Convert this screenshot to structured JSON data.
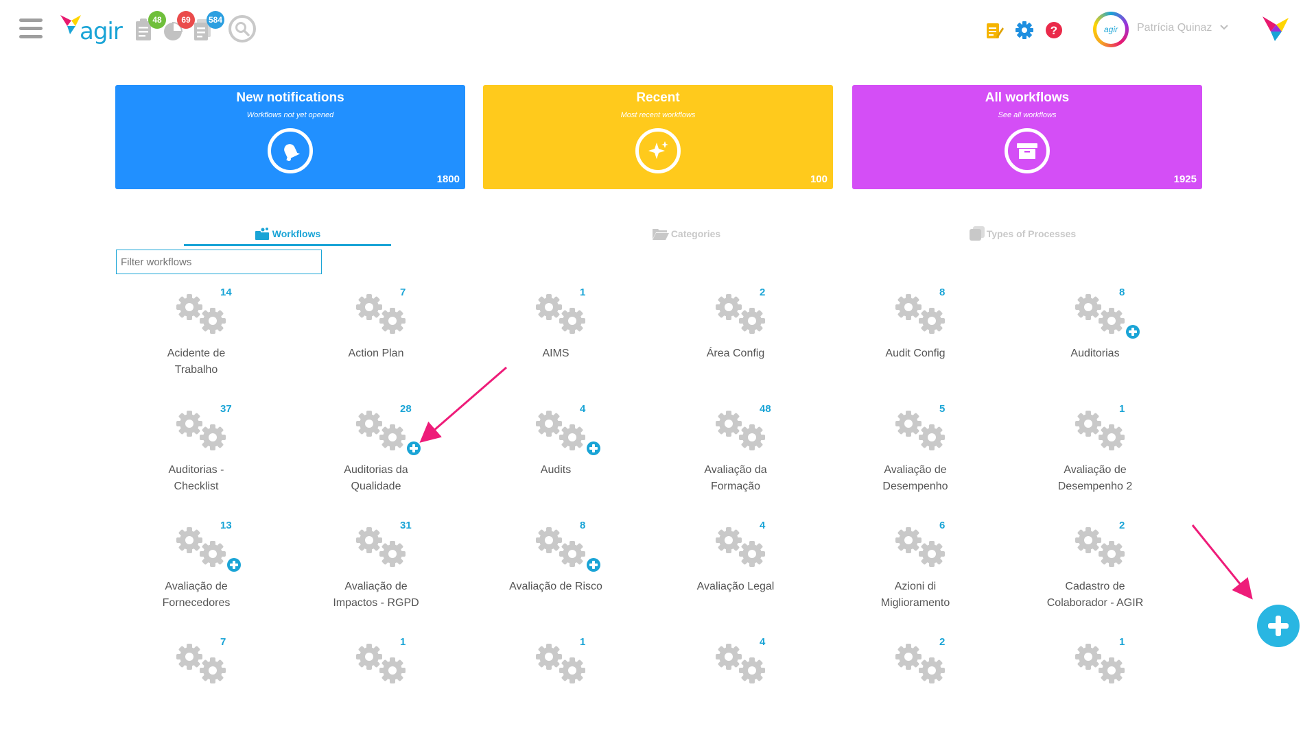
{
  "header": {
    "logo_text": "agir",
    "badges": {
      "tasks": "48",
      "charts": "69",
      "documents": "584"
    },
    "avatar_text": "agir",
    "user_name": "Patrícia Quinaz"
  },
  "cards": [
    {
      "title": "New notifications",
      "subtitle": "Workflows not yet opened",
      "count": "1800",
      "color": "#2190ff"
    },
    {
      "title": "Recent",
      "subtitle": "Most recent workflows",
      "count": "100",
      "color": "#ffca1c"
    },
    {
      "title": "All workflows",
      "subtitle": "See all workflows",
      "count": "1925",
      "color": "#d44ef6"
    }
  ],
  "tabs": {
    "workflows": "Workflows",
    "categories": "Categories",
    "types": "Types of Processes"
  },
  "filter": {
    "placeholder": "Filter workflows"
  },
  "workflows": [
    {
      "line1": "Acidente de",
      "line2": "Trabalho",
      "count": "14",
      "plus": false
    },
    {
      "line1": "Action Plan",
      "line2": "",
      "count": "7",
      "plus": false
    },
    {
      "line1": "AIMS",
      "line2": "",
      "count": "1",
      "plus": false
    },
    {
      "line1": "Área Config",
      "line2": "",
      "count": "2",
      "plus": false
    },
    {
      "line1": "Audit Config",
      "line2": "",
      "count": "8",
      "plus": false
    },
    {
      "line1": "Auditorias",
      "line2": "",
      "count": "8",
      "plus": true
    },
    {
      "line1": "Auditorias -",
      "line2": "Checklist",
      "count": "37",
      "plus": false
    },
    {
      "line1": "Auditorias da",
      "line2": "Qualidade",
      "count": "28",
      "plus": true
    },
    {
      "line1": "Audits",
      "line2": "",
      "count": "4",
      "plus": true
    },
    {
      "line1": "Avaliação da",
      "line2": "Formação",
      "count": "48",
      "plus": false
    },
    {
      "line1": "Avaliação de",
      "line2": "Desempenho",
      "count": "5",
      "plus": false
    },
    {
      "line1": "Avaliação de",
      "line2": "Desempenho 2",
      "count": "1",
      "plus": false
    },
    {
      "line1": "Avaliação de",
      "line2": "Fornecedores",
      "count": "13",
      "plus": true
    },
    {
      "line1": "Avaliação de",
      "line2": "Impactos - RGPD",
      "count": "31",
      "plus": false
    },
    {
      "line1": "Avaliação de Risco",
      "line2": "",
      "count": "8",
      "plus": true
    },
    {
      "line1": "Avaliação Legal",
      "line2": "",
      "count": "4",
      "plus": false
    },
    {
      "line1": "Azioni di",
      "line2": "Miglioramento",
      "count": "6",
      "plus": false
    },
    {
      "line1": "Cadastro de",
      "line2": "Colaborador - AGIR",
      "count": "2",
      "plus": false
    },
    {
      "line1": "",
      "line2": "",
      "count": "7",
      "plus": false
    },
    {
      "line1": "",
      "line2": "",
      "count": "1",
      "plus": false
    },
    {
      "line1": "",
      "line2": "",
      "count": "1",
      "plus": false
    },
    {
      "line1": "",
      "line2": "",
      "count": "4",
      "plus": false
    },
    {
      "line1": "",
      "line2": "",
      "count": "2",
      "plus": false
    },
    {
      "line1": "",
      "line2": "",
      "count": "1",
      "plus": false
    }
  ],
  "colors": {
    "accent": "#1aa4d6",
    "fab": "#29b6e2",
    "arrow": "#ee1c79"
  }
}
